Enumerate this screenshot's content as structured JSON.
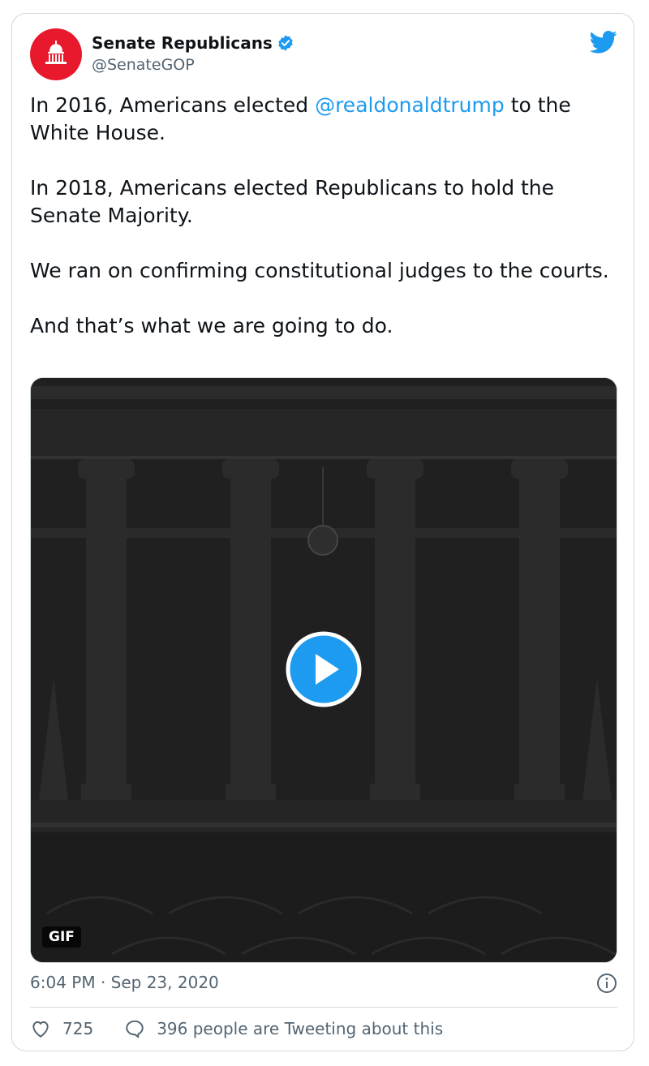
{
  "author": {
    "name": "Senate Republicans",
    "handle": "@SenateGOP"
  },
  "tweet": {
    "line1_pre": "In 2016, Americans elected ",
    "mention": "@realdonaldtrump",
    "line1_post": " to the White House.",
    "para2": "In 2018, Americans elected Republicans to hold the Senate Majority.",
    "para3": "We ran on confirming constitutional judges to the courts.",
    "para4": "And that’s what we are going to do."
  },
  "media": {
    "badge": "GIF"
  },
  "meta": {
    "timestamp": "6:04 PM · Sep 23, 2020"
  },
  "actions": {
    "likes": "725",
    "conversation": "396 people are Tweeting about this"
  },
  "icons": {
    "avatar": "capitol-dome-icon",
    "verified": "verified-badge-icon",
    "brand": "twitter-bird-icon",
    "play": "play-icon",
    "info": "info-icon",
    "like": "heart-icon",
    "reply": "speech-bubble-icon"
  },
  "colors": {
    "accent": "#1d9bf0",
    "avatar_bg": "#e8192c"
  }
}
